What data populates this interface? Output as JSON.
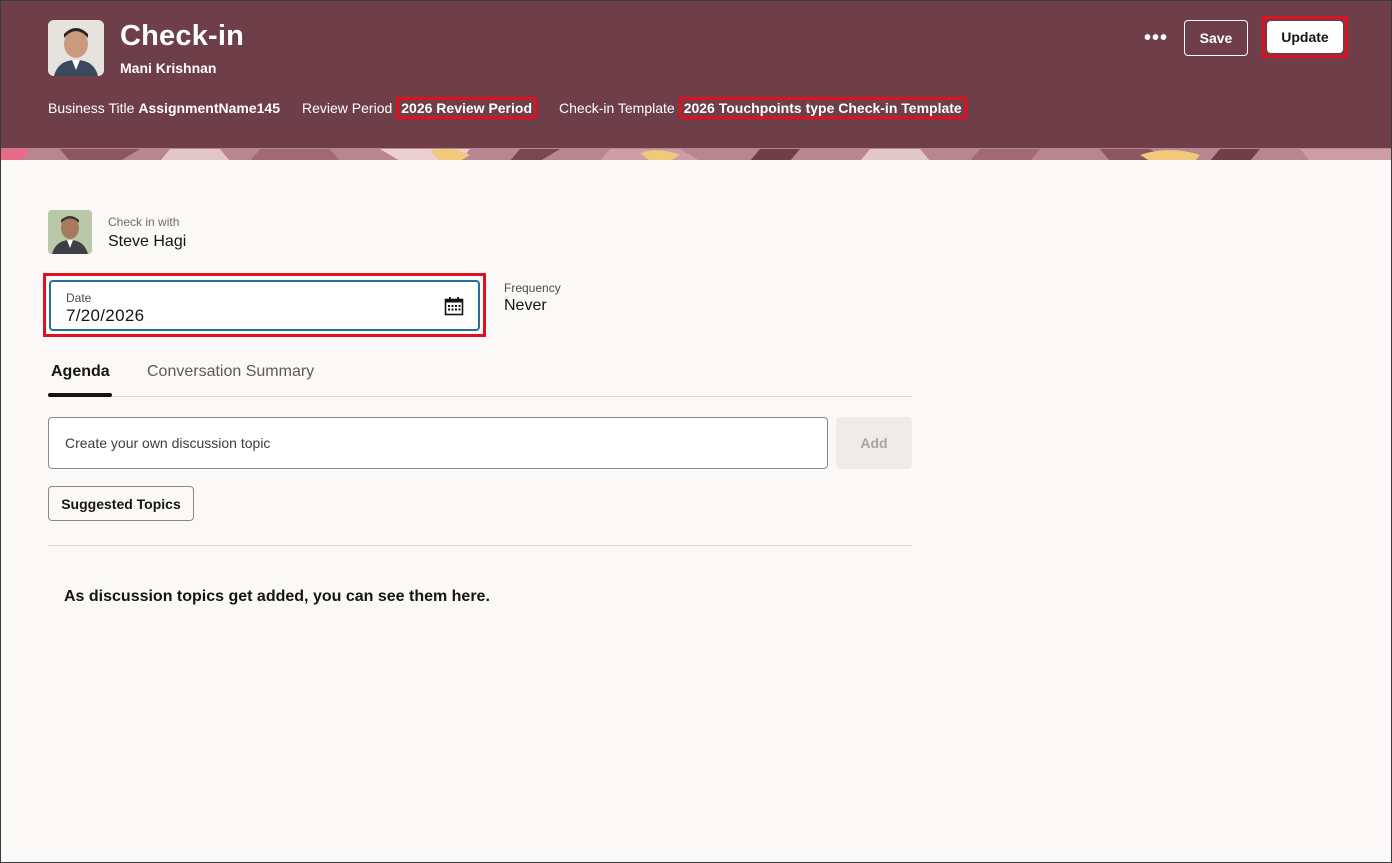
{
  "header": {
    "title": "Check-in",
    "subtitle": "Mani Krishnan",
    "meta": [
      {
        "label": "Business Title",
        "value": "AssignmentName145"
      },
      {
        "label": "Review Period",
        "value": "2026 Review Period"
      },
      {
        "label": "Check-in Template",
        "value": "2026 Touchpoints type Check-in Template"
      }
    ],
    "more_label": "•••",
    "save_label": "Save",
    "update_label": "Update",
    "colors": {
      "background": "#6e3f48",
      "highlight": "#e0101e"
    }
  },
  "checkin": {
    "with_label": "Check in with",
    "with_name": "Steve Hagi"
  },
  "date_field": {
    "label": "Date",
    "value": "7/20/2026",
    "icon": "calendar-icon"
  },
  "frequency": {
    "label": "Frequency",
    "value": "Never"
  },
  "tabs": [
    {
      "label": "Agenda",
      "active": true
    },
    {
      "label": "Conversation Summary",
      "active": false
    }
  ],
  "agenda": {
    "topic_placeholder": "Create your own discussion topic",
    "add_label": "Add",
    "suggested_label": "Suggested Topics",
    "empty_message": "As discussion topics get added, you can see them here."
  }
}
